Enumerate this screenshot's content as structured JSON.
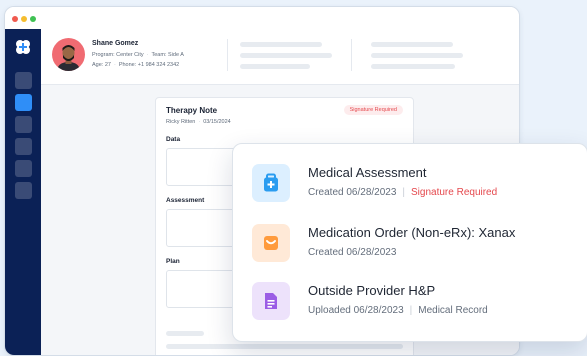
{
  "window": {
    "sidebar_nav": [
      {
        "name": "nav-item-1",
        "active": false
      },
      {
        "name": "nav-item-2",
        "active": true
      },
      {
        "name": "nav-item-3",
        "active": false
      },
      {
        "name": "nav-item-4",
        "active": false
      },
      {
        "name": "nav-item-5",
        "active": false
      },
      {
        "name": "nav-item-6",
        "active": false
      }
    ]
  },
  "patient": {
    "name": "Shane Gomez",
    "program_label": "Program: Center City",
    "team_label": "Team: Side A",
    "age_label": "Age: 27",
    "phone_label": "Phone: +1 984 324 2342"
  },
  "note": {
    "title": "Therapy Note",
    "author": "Ricky Ritten",
    "date": "03/15/2024",
    "badge": "Signature Required",
    "sections": [
      "Data",
      "Assessment",
      "Plan"
    ]
  },
  "documents": [
    {
      "title": "Medical Assessment",
      "meta": "Created 06/28/2023",
      "status": "Signature Required",
      "icon": "medical-bag-icon"
    },
    {
      "title": "Medication Order (Non-eRx): Xanax",
      "meta": "Created 06/28/2023",
      "icon": "pill-bag-icon"
    },
    {
      "title": "Outside Provider H&P",
      "meta": "Uploaded 06/28/2023",
      "status": "Medical Record",
      "icon": "document-icon"
    }
  ],
  "colors": {
    "sidebar": "#0b2156",
    "accent": "#2f8ef7",
    "danger": "#e5484d",
    "icon_blue_bg": "#dcefff",
    "icon_orange_bg": "#ffe9d7",
    "icon_purple_bg": "#ede2fb"
  }
}
